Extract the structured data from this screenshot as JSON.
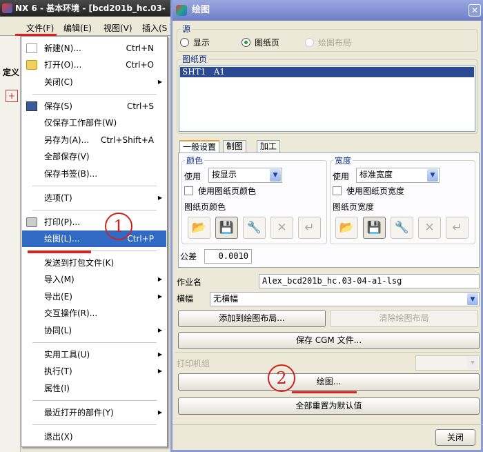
{
  "app": {
    "title": "NX 6 - 基本环境 - [bcd201b_hc.03-",
    "menubar": [
      "文件(F)",
      "编辑(E)",
      "视图(V)",
      "插入(S"
    ],
    "left_label": "定义"
  },
  "file_menu": {
    "items": [
      {
        "label": "新建(N)...",
        "shortcut": "Ctrl+N",
        "icon": "new-file-icon"
      },
      {
        "label": "打开(O)...",
        "shortcut": "Ctrl+O",
        "icon": "open-folder-icon"
      },
      {
        "label": "关闭(C)",
        "submenu": true
      },
      {
        "label": "保存(S)",
        "shortcut": "Ctrl+S",
        "icon": "save-icon"
      },
      {
        "label": "仅保存工作部件(W)"
      },
      {
        "label": "另存为(A)...",
        "shortcut": "Ctrl+Shift+A"
      },
      {
        "label": "全部保存(V)"
      },
      {
        "label": "保存书签(B)..."
      },
      {
        "label": "选项(T)",
        "submenu": true
      },
      {
        "label": "打印(P)...",
        "icon": "printer-icon"
      },
      {
        "label": "绘图(L)...",
        "shortcut": "Ctrl+P",
        "highlighted": true
      },
      {
        "label": "发送到打包文件(K)"
      },
      {
        "label": "导入(M)",
        "submenu": true
      },
      {
        "label": "导出(E)",
        "submenu": true
      },
      {
        "label": "交互操作(R)..."
      },
      {
        "label": "协同(L)",
        "submenu": true
      },
      {
        "label": "实用工具(U)",
        "submenu": true
      },
      {
        "label": "执行(T)",
        "submenu": true
      },
      {
        "label": "属性(I)"
      },
      {
        "label": "最近打开的部件(Y)",
        "submenu": true
      },
      {
        "label": "退出(X)"
      }
    ]
  },
  "annotations": {
    "step1": "1",
    "step2": "2"
  },
  "dialog": {
    "title": "绘图",
    "source": {
      "label": "源",
      "options": [
        "显示",
        "图纸页",
        "绘图布局"
      ],
      "selected": "图纸页"
    },
    "sheets": {
      "label": "图纸页",
      "items": [
        "SHT1   A1"
      ]
    },
    "tabs": [
      "一般设置",
      "制图",
      "加工"
    ],
    "color": {
      "label": "颜色",
      "use_label": "使用",
      "use_value": "按显示",
      "checkbox": "使用图纸页颜色",
      "sheet_label": "图纸页颜色"
    },
    "width": {
      "label": "宽度",
      "use_label": "使用",
      "use_value": "标准宽度",
      "checkbox": "使用图纸页宽度",
      "sheet_label": "图纸页宽度"
    },
    "tolerance": {
      "label": "公差",
      "value": "0.0010"
    },
    "job_name": {
      "label": "作业名",
      "value": "Alex_bcd201b_hc.03-04-a1-lsg"
    },
    "banner": {
      "label": "横幅",
      "value": "无横幅"
    },
    "buttons": {
      "add_layout": "添加到绘图布局...",
      "clear_layout": "清除绘图布局",
      "save_cgm": "保存 CGM 文件...",
      "plot": "绘图...",
      "reset": "全部重置为默认值",
      "close": "关闭"
    },
    "printer_group": {
      "label": "打印机组",
      "value": ""
    }
  },
  "colors": {
    "highlight": "#316ac5",
    "annotation": "#d42020"
  }
}
